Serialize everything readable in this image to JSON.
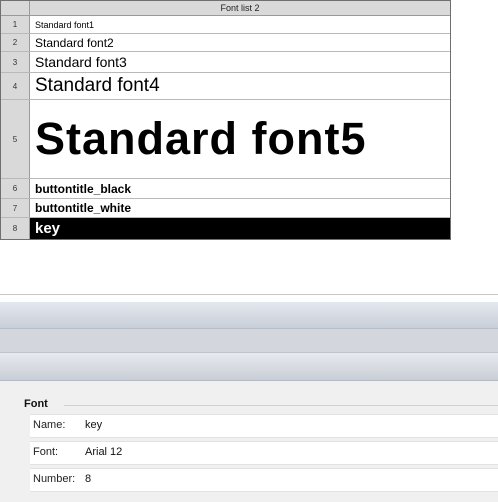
{
  "font_list": {
    "title": "Font list 2",
    "rows": [
      {
        "num": "1",
        "label": "Standard font1"
      },
      {
        "num": "2",
        "label": "Standard font2"
      },
      {
        "num": "3",
        "label": "Standard font3"
      },
      {
        "num": "4",
        "label": "Standard font4"
      },
      {
        "num": "5",
        "label": "Standard font5"
      },
      {
        "num": "6",
        "label": "buttontitle_black"
      },
      {
        "num": "7",
        "label": "buttontitle_white"
      },
      {
        "num": "8",
        "label": "key"
      }
    ],
    "selected_row": "8"
  },
  "properties": {
    "group_title": "Font",
    "name_label": "Name:",
    "name_value": "key",
    "font_label": "Font:",
    "font_value": "Arial 12",
    "number_label": "Number:",
    "number_value": "8"
  },
  "colors": {
    "selected_row_bg": "#000000",
    "selected_row_text": "#ffffff",
    "header_bg": "#d9d9d9"
  }
}
